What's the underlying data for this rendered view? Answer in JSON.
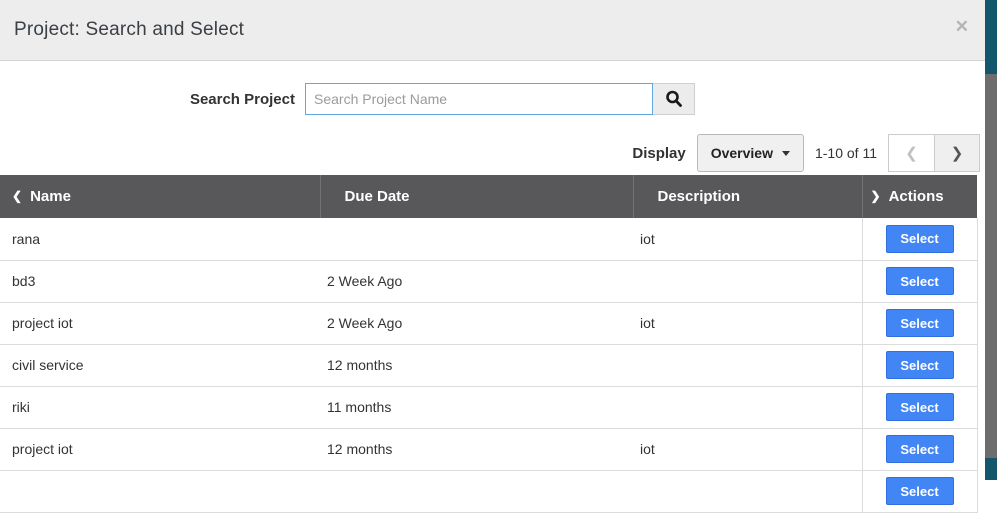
{
  "modal": {
    "title": "Project: Search and Select"
  },
  "icons": {
    "close": "✕",
    "prev": "❮",
    "next": "❯",
    "col_prev": "❮",
    "col_next": "❯"
  },
  "search": {
    "label": "Search Project",
    "placeholder": "Search Project Name",
    "value": ""
  },
  "toolbar": {
    "display_label": "Display",
    "display_value": "Overview",
    "range_text": "1-10 of 11"
  },
  "table": {
    "columns": [
      {
        "label": "Name"
      },
      {
        "label": "Due Date"
      },
      {
        "label": "Description"
      },
      {
        "label": "Actions"
      }
    ],
    "select_label": "Select",
    "rows": [
      {
        "name": "rana",
        "due": "",
        "desc": "iot",
        "action": "Select"
      },
      {
        "name": "bd3",
        "due": "2 Week Ago",
        "desc": "",
        "action": "Select"
      },
      {
        "name": "project iot",
        "due": "2 Week Ago",
        "desc": "iot",
        "action": "Select"
      },
      {
        "name": "civil service",
        "due": "12 months",
        "desc": "",
        "action": "Select"
      },
      {
        "name": "riki",
        "due": "11 months",
        "desc": "",
        "action": "Select"
      },
      {
        "name": "project iot",
        "due": "12 months",
        "desc": "iot",
        "action": "Select"
      },
      {
        "name": "",
        "due": "",
        "desc": "",
        "action": "Select"
      }
    ]
  },
  "colors": {
    "accent_blue": "#4285f4",
    "table_header_bg": "#58585b",
    "modal_header_bg": "#ededed",
    "input_border_blue": "#5ca9e6",
    "page_edge_teal": "#14566b",
    "scrollbar_thumb": "#6d6d6d"
  }
}
